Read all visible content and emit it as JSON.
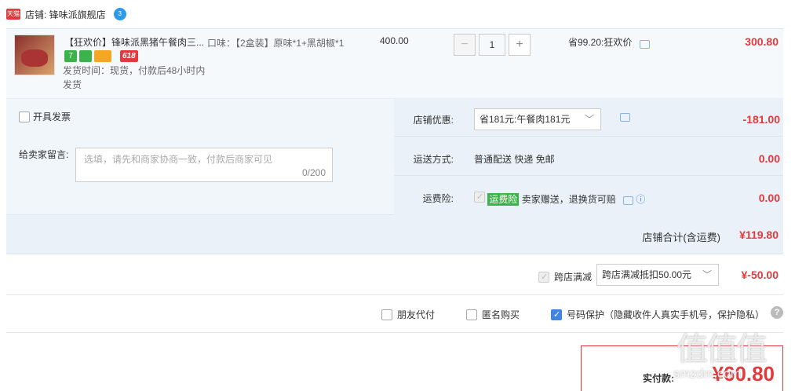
{
  "shop": {
    "logo_text": "天猫",
    "label": "店铺: 锋味派旗舰店",
    "ww_badge": "3"
  },
  "item": {
    "title": "【狂欢价】锋味派黑猪午餐肉三...",
    "badges": [
      "7",
      "",
      "",
      "618"
    ],
    "ship": "发货时间：现货，付款后48小时内发货",
    "spec": "口味：【2盒装】原味*1+黑胡椒*1",
    "price": "400.00",
    "qty_minus": "−",
    "qty": "1",
    "qty_plus": "+",
    "promo": "省99.20:狂欢价",
    "total": "300.80"
  },
  "options": {
    "invoice_label": "开具发票",
    "message_label": "给卖家留言:",
    "message_placeholder": "选填，请先和商家协商一致，付款后商家可见",
    "message_count": "0/200",
    "shop_discount": {
      "label": "店铺优惠:",
      "select": "省181元:午餐肉181元",
      "amount": "-181.00"
    },
    "shipping": {
      "label": "运送方式:",
      "value": "普通配送 快递 免邮",
      "amount": "0.00"
    },
    "insurance": {
      "label": "运费险:",
      "tag": "运费险",
      "value": "卖家赠送，退换货可赔",
      "amount": "0.00"
    }
  },
  "shop_total": {
    "label": "店铺合计(含运费)",
    "value": "¥119.80"
  },
  "cross_store": {
    "label": "跨店满减",
    "select": "跨店满减抵扣50.00元",
    "amount": "¥-50.00"
  },
  "pay_options": {
    "friend_pay": "朋友代付",
    "anonymous": "匿名购买",
    "number_protect": "号码保护（隐藏收件人真实手机号，保护隐私）",
    "help": "?"
  },
  "payment": {
    "label": "实付款:",
    "value": "¥60.80"
  },
  "watermark": {
    "big": "值值值",
    "small": "smzdm.com"
  }
}
